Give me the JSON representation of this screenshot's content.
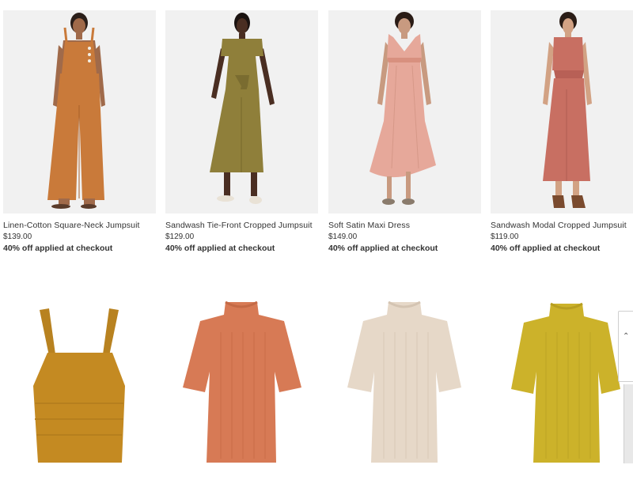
{
  "products": [
    {
      "name": "Linen-Cotton Square-Neck Jumpsuit",
      "price": "$139.00",
      "promo": "40% off applied at checkout",
      "colors": {
        "garment": "#c97a3a",
        "skin": "#a06a4a"
      }
    },
    {
      "name": "Sandwash Tie-Front Cropped Jumpsuit",
      "price": "$129.00",
      "promo": "40% off applied at checkout",
      "colors": {
        "garment": "#8f7f3a",
        "skin": "#4a2e22"
      }
    },
    {
      "name": "Soft Satin Maxi Dress",
      "price": "$149.00",
      "promo": "40% off applied at checkout",
      "colors": {
        "garment": "#e6a89a",
        "skin": "#c89a80"
      }
    },
    {
      "name": "Sandwash Modal Cropped Jumpsuit",
      "price": "$119.00",
      "promo": "40% off applied at checkout",
      "colors": {
        "garment": "#c86f62",
        "skin": "#d2a284"
      }
    }
  ],
  "row2_colors": [
    "#c48a22",
    "#d77a55",
    "#e6d8c8",
    "#ccb22a"
  ]
}
